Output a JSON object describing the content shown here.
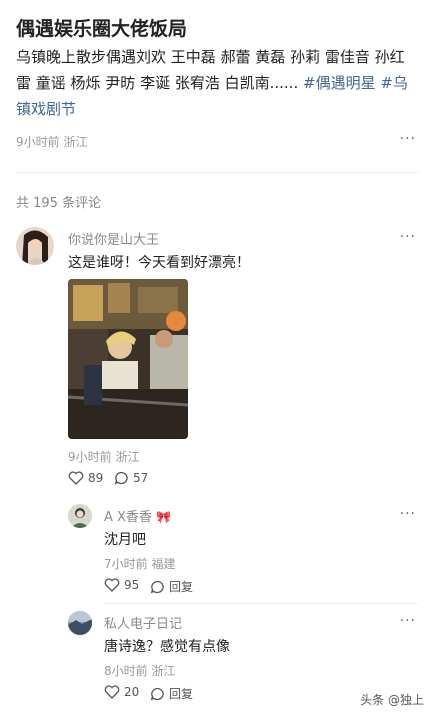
{
  "post": {
    "title": "偶遇娱乐圈大佬饭局",
    "body_text": "乌镇晚上散步偶遇刘欢 王中磊 郝蕾 黄磊 孙莉 雷佳音 孙红雷 童谣 杨烁 尹昉 李诞 张宥浩 白凯南...... ",
    "tag1": "#偶遇明星",
    "tag2": "#乌镇戏剧节",
    "meta": "9小时前 浙江",
    "more": "···"
  },
  "comments_header": "共 195 条评论",
  "comments": [
    {
      "user": "你说你是山大王",
      "text": "这是谁呀！今天看到好漂亮！",
      "meta": "9小时前 浙江",
      "likes": "89",
      "replies": "57",
      "more": "···"
    }
  ],
  "replies": [
    {
      "user": "A X香香",
      "user_emoji": "🎀",
      "text": "沈月吧",
      "meta": "7小时前 福建",
      "likes": "95",
      "reply_label": "回复",
      "more": "···"
    },
    {
      "user": "私人电子日记",
      "text": "唐诗逸？感觉有点像",
      "meta": "8小时前 浙江",
      "likes": "20",
      "reply_label": "回复",
      "more": "···"
    }
  ],
  "watermark": "头条 @独上",
  "colors": {
    "tag": "#406599",
    "meta": "#999999",
    "divider": "#eeeeee"
  },
  "icons": [
    "heart-icon",
    "comment-icon",
    "more-icon"
  ]
}
